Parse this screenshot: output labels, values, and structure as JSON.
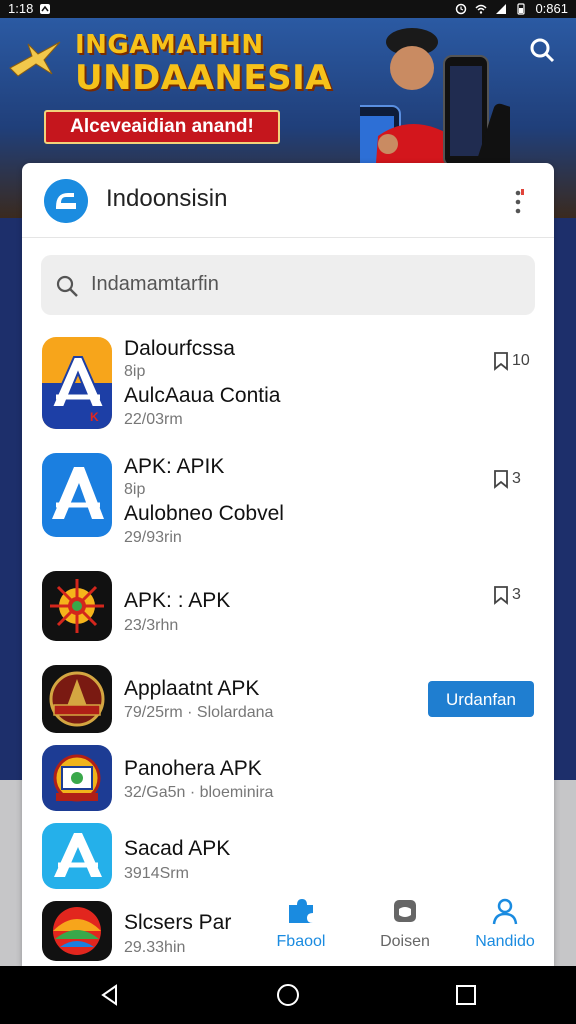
{
  "status_bar": {
    "time": "1:18",
    "right_text": "0:861"
  },
  "banner": {
    "headline_1": "INGAMAHHN",
    "headline_2": "UNDAANESIA",
    "ribbon": "Alceveaidian anand!"
  },
  "header": {
    "title": "Indoonsisin"
  },
  "search": {
    "placeholder": "Indamamtarfin"
  },
  "apps": [
    {
      "name": "Dalourfcssa",
      "sub": "8ip",
      "name2": "AulcAaua Contia",
      "meta": "22/03rm",
      "bookmark_count": "10"
    },
    {
      "name": "APK: APIK",
      "sub": "8ip",
      "name2": "Aulobneo Cobvel",
      "meta": "29/93rin",
      "bookmark_count": "3"
    },
    {
      "name": "APK: : APK",
      "meta": "23/3rhn",
      "bookmark_count": "3"
    },
    {
      "name": "Applaatnt APK",
      "meta": "79/25rm · Slolardana",
      "action_label": "Urdanfan"
    },
    {
      "name": "Panohera APK",
      "meta": "32/Ga5n · bloeminira"
    },
    {
      "name": "Sacad APK",
      "meta": "3914Srm"
    },
    {
      "name": "Slcsers Par",
      "meta": "29.33hin"
    }
  ],
  "tabs": [
    {
      "label": "Fbaool",
      "icon": "puzzle-icon",
      "color": "#1a8be0"
    },
    {
      "label": "Doisen",
      "icon": "shield-icon",
      "color": "#666666"
    },
    {
      "label": "Nandido",
      "icon": "person-icon",
      "color": "#1a8be0"
    }
  ],
  "colors": {
    "accent": "#1f7ed0",
    "banner_yellow": "#f6c21a",
    "ribbon_red": "#c5161d"
  }
}
